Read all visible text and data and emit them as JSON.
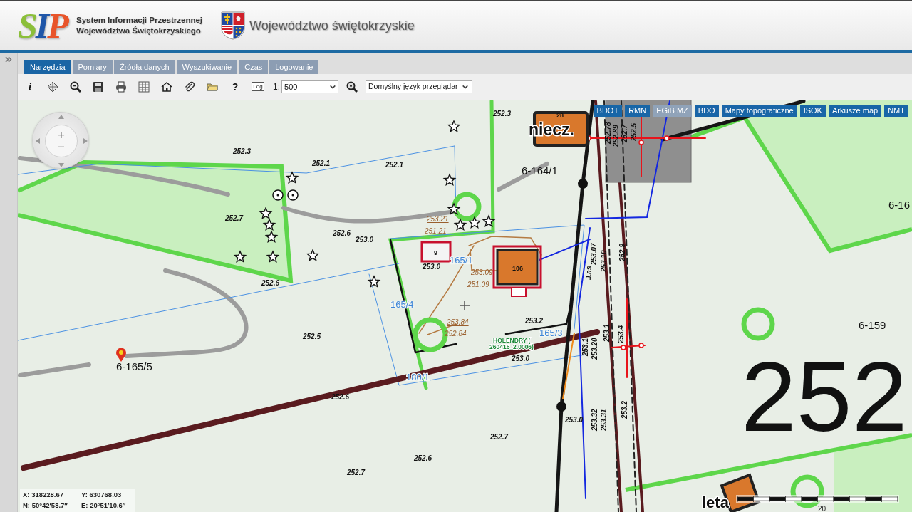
{
  "header": {
    "logo": "SIP",
    "title_lines": [
      "System Informacji Przestrzennej",
      "Województwa Świętokrzyskiego"
    ],
    "region": "Województwo świętokrzyskie"
  },
  "tabs": [
    {
      "label": "Narzędzia",
      "selected": true
    },
    {
      "label": "Pomiary",
      "selected": false
    },
    {
      "label": "Źródła danych",
      "selected": false
    },
    {
      "label": "Wyszukiwanie",
      "selected": false
    },
    {
      "label": "Czas",
      "selected": false
    },
    {
      "label": "Logowanie",
      "selected": false
    }
  ],
  "toolbar": {
    "tools": [
      {
        "kind": "info",
        "glyph": "i"
      },
      {
        "kind": "layers"
      },
      {
        "kind": "zoom_out"
      },
      {
        "kind": "save"
      },
      {
        "kind": "print"
      },
      {
        "kind": "table"
      },
      {
        "kind": "home"
      },
      {
        "kind": "attach"
      },
      {
        "kind": "folder"
      },
      {
        "kind": "help",
        "glyph": "?"
      },
      {
        "kind": "log",
        "glyph": "Log"
      }
    ],
    "scale_prefix": "1:",
    "scale": "500",
    "language": "Domyślny język przeglądar"
  },
  "map": {
    "zoom_in": "+",
    "zoom_out": "−",
    "layers": [
      {
        "label": "BDOT",
        "selected": false
      },
      {
        "label": "RMN",
        "selected": false
      },
      {
        "label": "EGiB MZ",
        "selected": true
      },
      {
        "label": "BDO",
        "selected": false
      },
      {
        "label": "Mapy topograficzne",
        "selected": false
      },
      {
        "label": "ISOK",
        "selected": false
      },
      {
        "label": "Arkusze map",
        "selected": false
      },
      {
        "label": "NMT",
        "selected": false
      }
    ],
    "labels": [
      {
        "text": "252.3",
        "kind": "height"
      },
      {
        "text": "28",
        "kind": "number"
      },
      {
        "text": "252.78",
        "kind": "vertical"
      },
      {
        "text": "252.89",
        "kind": "vertical"
      },
      {
        "text": "252.7",
        "kind": "vertical"
      },
      {
        "text": "252.5",
        "kind": "vertical"
      },
      {
        "text": "niecz.",
        "kind": "place"
      },
      {
        "text": "252.3",
        "kind": "height"
      },
      {
        "text": "252.1",
        "kind": "height"
      },
      {
        "text": "252.1",
        "kind": "height"
      },
      {
        "text": "6-164/1",
        "kind": "parcel_id"
      },
      {
        "text": "6-16",
        "kind": "parcel_id"
      },
      {
        "text": "252.7",
        "kind": "height"
      },
      {
        "text": "253.21",
        "kind": "measure",
        "underlined": true
      },
      {
        "text": "251.21",
        "kind": "measure",
        "underlined": false
      },
      {
        "text": "252.6",
        "kind": "height"
      },
      {
        "text": "253.0",
        "kind": "height"
      },
      {
        "text": "9",
        "kind": "number"
      },
      {
        "text": "165/1",
        "kind": "parcel_number"
      },
      {
        "text": "253.07",
        "kind": "vertical"
      },
      {
        "text": "J.as",
        "kind": "vertical"
      },
      {
        "text": "253.10",
        "kind": "vertical"
      },
      {
        "text": "252.9",
        "kind": "vertical"
      },
      {
        "text": "253.0",
        "kind": "height"
      },
      {
        "text": "106",
        "kind": "number"
      },
      {
        "text": "253.09",
        "kind": "measure",
        "underlined": true
      },
      {
        "text": "252.6",
        "kind": "height"
      },
      {
        "text": "251.09",
        "kind": "measure",
        "underlined": false
      },
      {
        "text": "165/4",
        "kind": "parcel_number"
      },
      {
        "text": "253.84",
        "kind": "measure",
        "underlined": true
      },
      {
        "text": "253.2",
        "kind": "height"
      },
      {
        "text": "6-159",
        "kind": "parcel_id"
      },
      {
        "text": "252.5",
        "kind": "height"
      },
      {
        "text": "252.84",
        "kind": "measure",
        "underlined": false
      },
      {
        "text": "165/3",
        "kind": "parcel_number"
      },
      {
        "text": "HOLENDRY (",
        "kind": "locality"
      },
      {
        "text": "260415_2.0006)",
        "kind": "locality"
      },
      {
        "text": "253.1",
        "kind": "vertical"
      },
      {
        "text": "253.20",
        "kind": "vertical"
      },
      {
        "text": "253.1",
        "kind": "vertical"
      },
      {
        "text": "253.4",
        "kind": "vertical"
      },
      {
        "text": "253.0",
        "kind": "height"
      },
      {
        "text": "6-165/5",
        "kind": "parcel_id"
      },
      {
        "text": "180/1",
        "kind": "parcel_number"
      },
      {
        "text": "252.6",
        "kind": "height"
      },
      {
        "text": "253.0",
        "kind": "height"
      },
      {
        "text": "253.32",
        "kind": "vertical"
      },
      {
        "text": "253.31",
        "kind": "vertical"
      },
      {
        "text": "253.2",
        "kind": "vertical"
      },
      {
        "text": "252.7",
        "kind": "height"
      },
      {
        "text": "252",
        "kind": "contour"
      },
      {
        "text": "252.6",
        "kind": "height"
      },
      {
        "text": "252.7",
        "kind": "height"
      },
      {
        "text": "leta",
        "kind": "place"
      }
    ],
    "coordinates": [
      "X: 318228.67",
      "Y: 630768.03",
      "N: 50°42′58.7″",
      "E: 20°51′10.6″"
    ],
    "scale_label": "20"
  }
}
